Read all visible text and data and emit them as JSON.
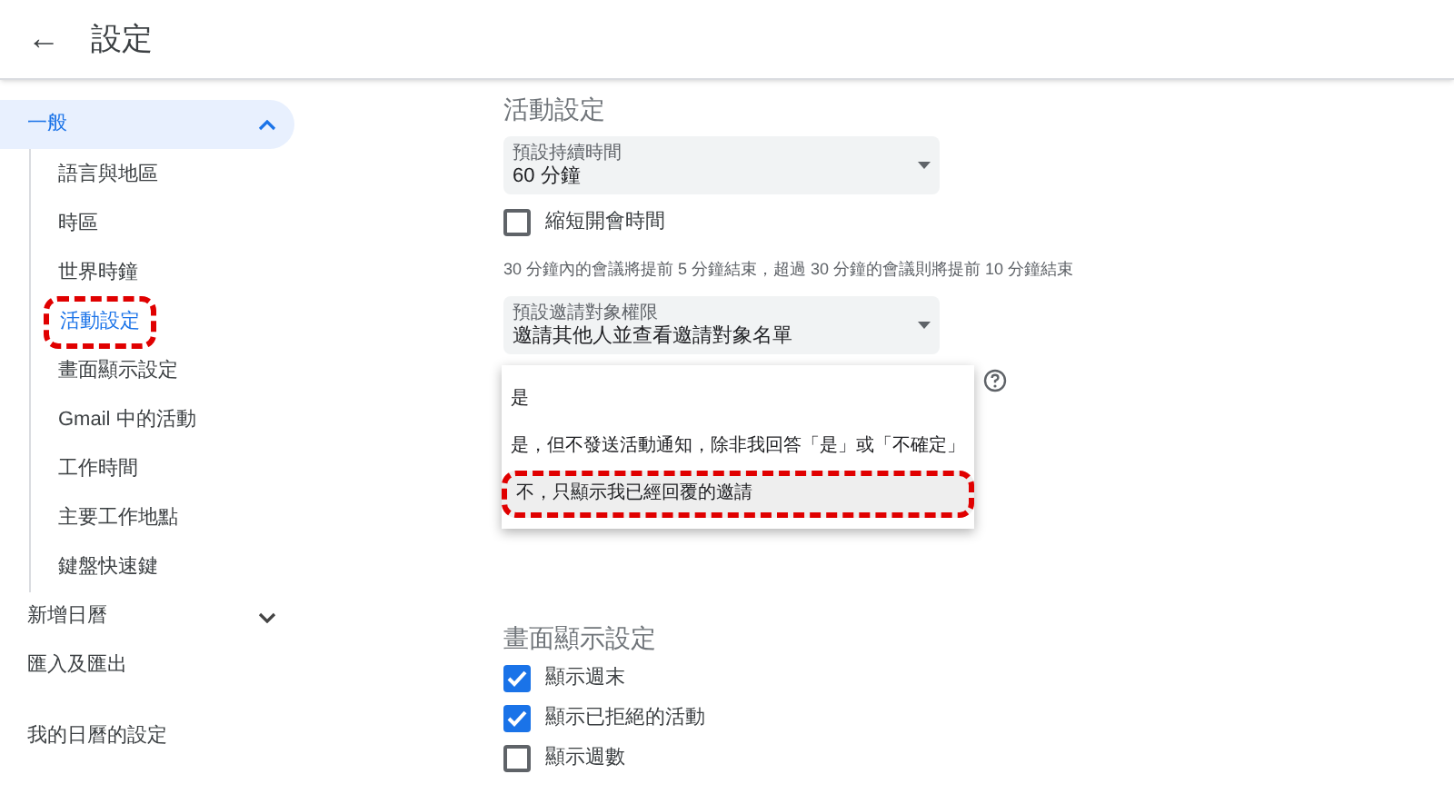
{
  "header": {
    "back": "←",
    "title": "設定"
  },
  "sidebar": {
    "items": [
      {
        "label": "一般",
        "selected": true,
        "expanded": true,
        "children": [
          {
            "label": "語言與地區",
            "selected": false,
            "highlight": false
          },
          {
            "label": "時區",
            "selected": false,
            "highlight": false
          },
          {
            "label": "世界時鐘",
            "selected": false,
            "highlight": false
          },
          {
            "label": "活動設定",
            "selected": true,
            "highlight": true
          },
          {
            "label": "畫面顯示設定",
            "selected": false,
            "highlight": false
          },
          {
            "label": "Gmail 中的活動",
            "selected": false,
            "highlight": false
          },
          {
            "label": "工作時間",
            "selected": false,
            "highlight": false
          },
          {
            "label": "主要工作地點",
            "selected": false,
            "highlight": false
          },
          {
            "label": "鍵盤快速鍵",
            "selected": false,
            "highlight": false
          }
        ]
      },
      {
        "label": "新增日曆",
        "selected": false,
        "expanded": false
      },
      {
        "label": "匯入及匯出",
        "selected": false
      }
    ],
    "section_title": "我的日曆的設定"
  },
  "event_settings": {
    "title": "活動設定",
    "duration": {
      "label": "預設持續時間",
      "value": "60 分鐘"
    },
    "speedy_meetings": {
      "label": "縮短開會時間",
      "checked": false
    },
    "hint": "30 分鐘內的會議將提前 5 分鐘結束，超過 30 分鐘的會議則將提前 10 分鐘結束",
    "guest_permissions": {
      "label": "預設邀請對象權限",
      "value": "邀請其他人並查看邀請對象名單"
    },
    "menu": {
      "options": [
        {
          "label": "是",
          "selected": false,
          "highlight": false
        },
        {
          "label": "是，但不發送活動通知，除非我回答「是」或「不確定」",
          "selected": false,
          "highlight": false
        },
        {
          "label": "不，只顯示我已經回覆的邀請",
          "selected": true,
          "highlight": true
        }
      ]
    }
  },
  "view_options": {
    "title": "畫面顯示設定",
    "options": [
      {
        "label": "顯示週末",
        "checked": true
      },
      {
        "label": "顯示已拒絕的活動",
        "checked": true
      },
      {
        "label": "顯示週數",
        "checked": false
      }
    ]
  }
}
